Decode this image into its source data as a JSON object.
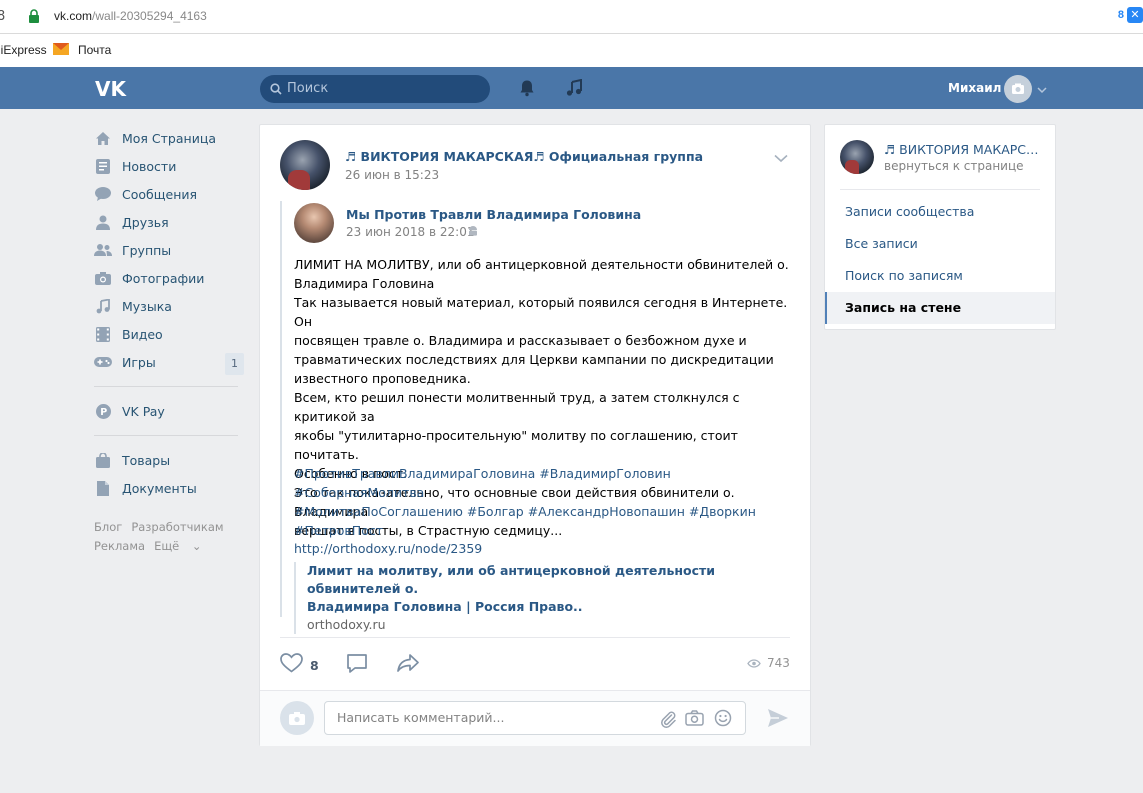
{
  "browser": {
    "left_glyph": "8",
    "url_host": "vk.com",
    "url_path": "/wall-20305294_4163",
    "count": "8",
    "bookmarks": [
      "liExpress",
      "Почта"
    ]
  },
  "header": {
    "search_placeholder": "Поиск",
    "user_name": "Михаил",
    "colors": {
      "header_bg": "#4a76a8",
      "search_bg": "#224b7a"
    }
  },
  "sidebar": {
    "items": [
      {
        "label": "Моя Страница",
        "icon": "home-icon"
      },
      {
        "label": "Новости",
        "icon": "news-icon"
      },
      {
        "label": "Сообщения",
        "icon": "messages-icon"
      },
      {
        "label": "Друзья",
        "icon": "friends-icon"
      },
      {
        "label": "Группы",
        "icon": "groups-icon"
      },
      {
        "label": "Фотографии",
        "icon": "camera-icon"
      },
      {
        "label": "Музыка",
        "icon": "music-icon"
      },
      {
        "label": "Видео",
        "icon": "video-icon"
      },
      {
        "label": "Игры",
        "icon": "gamepad-icon",
        "badge": "1"
      }
    ],
    "pay": {
      "label": "VK Pay",
      "icon": "vkpay-icon"
    },
    "extra": [
      {
        "label": "Товары",
        "icon": "bag-icon"
      },
      {
        "label": "Документы",
        "icon": "document-icon"
      }
    ],
    "footer": [
      "Блог",
      "Разработчикам",
      "Реклама",
      "Ещё"
    ]
  },
  "post": {
    "author": "♬ ВИКТОРИЯ МАКАРСКАЯ♬ Официальная группа",
    "date": "26 июн в 15:23",
    "repost": {
      "author": "Мы Против Травли Владимира Головина",
      "date": "23 июн 2018 в 22:01"
    },
    "text": [
      "ЛИМИТ НА МОЛИТВУ, или об антицерковной деятельности обвинителей о.",
      "Владимира Головина",
      "Так называется новый материал, который появился сегодня в Интернете. Он",
      "посвящен травле о. Владимира и рассказывает о безбожном духе и",
      "травматических последствиях для Церкви кампании по дискредитации",
      "известного проповедника.",
      "Всем, кто решил понести молитвенный труд, а затем столкнулся с критикой за",
      "якобы \"утилитарно-просительную\" молитву по соглашению, стоит почитать.",
      "Особенно в пост.",
      "Это так показательно, что основные свои действия обвинители о. Владимира",
      "вершат в посты, в Страстную седмицу..."
    ],
    "hashtags": [
      "#ПротивТравлиВладимираГоловина #ВладимирГоловин #СоборнаяМолитва",
      "#МолитваПоСоглашению #Болгар #АлександрНовопашин #Дворкин",
      "#ПетровПост"
    ],
    "link_url": "http://orthodoxy.ru/node/2359",
    "snippet": {
      "title_1": "Лимит на молитву, или об антицерковной деятельности обвинителей о.",
      "title_2": "Владимира Головина | Россия Право..",
      "domain": "orthodoxy.ru"
    },
    "likes": "8",
    "views": "743",
    "comment_placeholder": "Написать комментарий..."
  },
  "right_card": {
    "title": "♬ ВИКТОРИЯ МАКАРСКАЯ♬ Официальная группа",
    "back_label": "вернуться к странице",
    "menu": [
      {
        "label": "Записи сообщества",
        "active": false
      },
      {
        "label": "Все записи",
        "active": false
      },
      {
        "label": "Поиск по записям",
        "active": false
      },
      {
        "label": "Запись на стене",
        "active": true
      }
    ]
  }
}
